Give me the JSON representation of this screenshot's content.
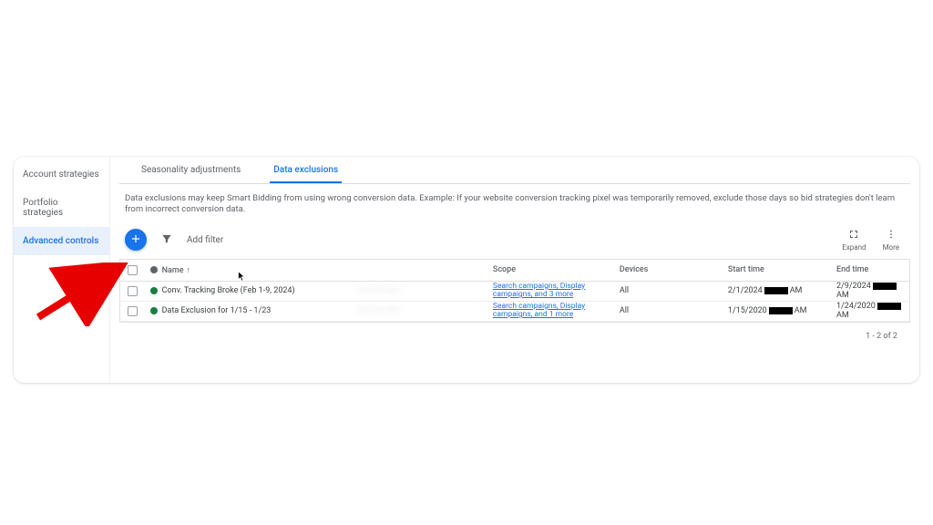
{
  "sidebar": {
    "items": [
      {
        "label": "Account strategies"
      },
      {
        "label": "Portfolio strategies"
      },
      {
        "label": "Advanced controls"
      }
    ],
    "active_index": 2
  },
  "tabs": {
    "items": [
      {
        "label": "Seasonality adjustments"
      },
      {
        "label": "Data exclusions"
      }
    ],
    "active_index": 1
  },
  "description": "Data exclusions may keep Smart Bidding from using wrong conversion data. Example: If your website conversion tracking pixel was temporarily removed, exclude those days so bid strategies don't learn from incorrect conversion data.",
  "toolbar": {
    "add_filter_label": "Add filter",
    "expand_label": "Expand",
    "more_label": "More"
  },
  "table": {
    "headers": {
      "name": "Name",
      "scope": "Scope",
      "devices": "Devices",
      "start": "Start time",
      "end": "End time"
    },
    "rows": [
      {
        "name": "Conv. Tracking Broke (Feb 1-9, 2024)",
        "scope_link": "Search campaigns, Display campaigns, and 3 more",
        "devices": "All",
        "start_date": "2/1/2024",
        "start_suffix": "AM",
        "end_date": "2/9/2024",
        "end_suffix": "AM"
      },
      {
        "name": "Data Exclusion for 1/15 - 1/23",
        "scope_link": "Search campaigns, Display campaigns, and 1 more",
        "devices": "All",
        "start_date": "1/15/2020",
        "start_suffix": "AM",
        "end_date": "1/24/2020",
        "end_suffix": "AM"
      }
    ],
    "pagination": "1 - 2 of 2"
  }
}
